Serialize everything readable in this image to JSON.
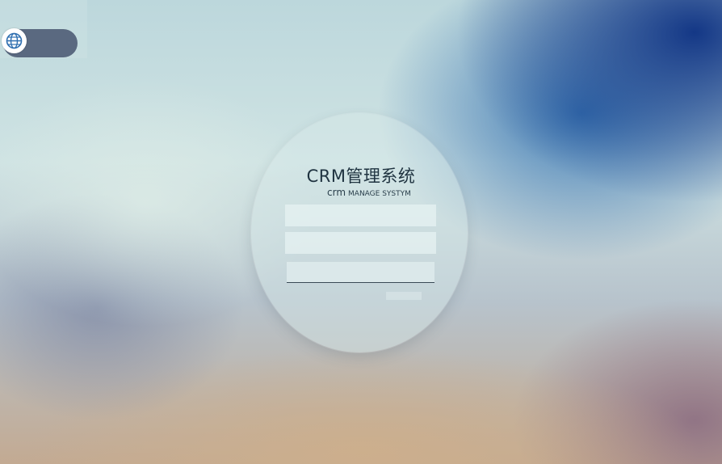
{
  "app": {
    "title": "CRM管理系统",
    "subtitle_crm": "crm",
    "subtitle_text": "MANAGE SYSTYM"
  },
  "language_toggle": {
    "icon": "globe-icon"
  },
  "login_form": {
    "username_value": "",
    "password_value": "",
    "captcha_value": "",
    "submit_label": ""
  },
  "colors": {
    "title_text": "#1f3340",
    "pill_background": "#46556e",
    "field_background": "#e8f3f4"
  }
}
